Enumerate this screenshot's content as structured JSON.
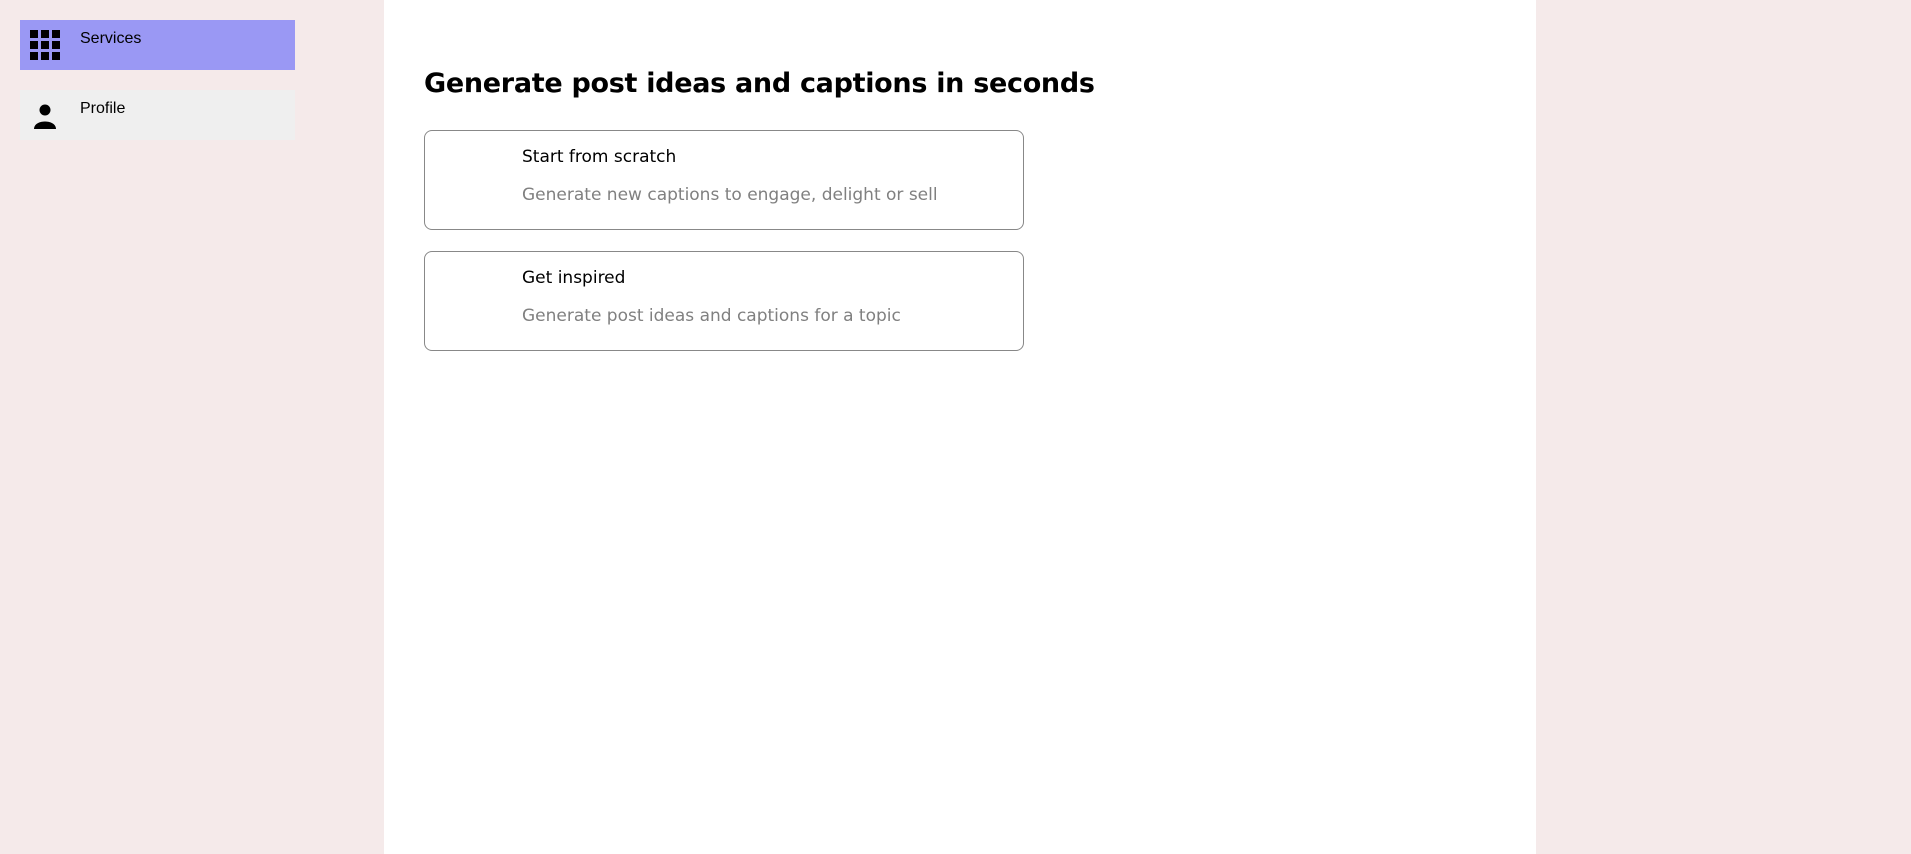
{
  "sidebar": {
    "items": [
      {
        "label": "Services",
        "icon": "grid-icon",
        "active": true
      },
      {
        "label": "Profile",
        "icon": "user-icon",
        "active": false
      }
    ]
  },
  "main": {
    "title": "Generate post ideas and captions in seconds",
    "cards": [
      {
        "title": "Start from scratch",
        "description": "Generate new captions to engage, delight or sell"
      },
      {
        "title": "Get inspired",
        "description": "Generate post ideas and captions for a topic"
      }
    ]
  },
  "colors": {
    "active_nav": "#9a98f4",
    "background": "#f5eaea"
  }
}
